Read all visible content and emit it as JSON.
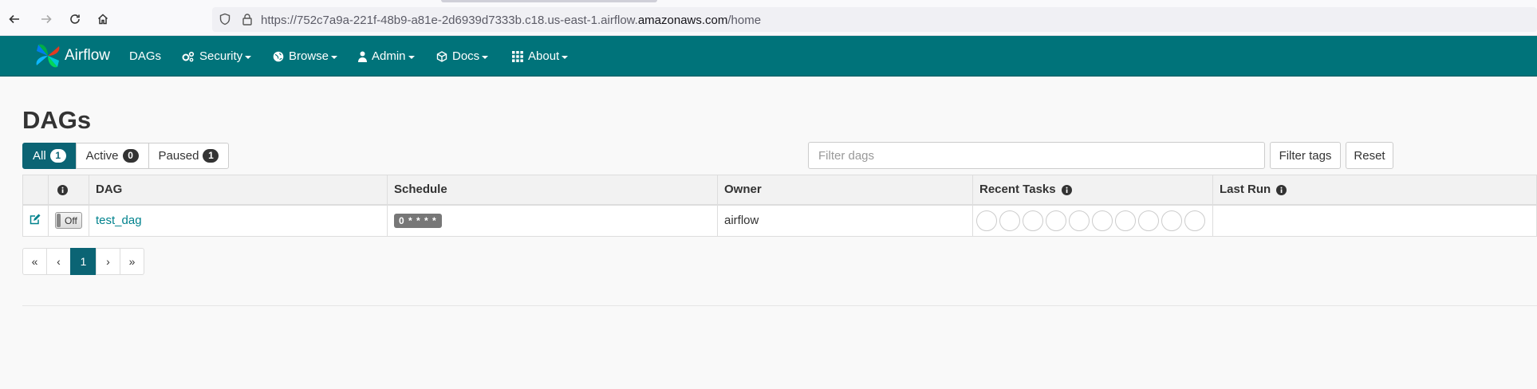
{
  "browser": {
    "url_prefix": "https://752c7a9a-221f-48b9-a81e-2d6939d7333b.c18.us-east-1.airflow.",
    "url_host": "amazonaws.com",
    "url_suffix": "/home"
  },
  "navbar": {
    "brand": "Airflow",
    "items": [
      {
        "label": "DAGs",
        "icon": "none"
      },
      {
        "label": "Security",
        "icon": "cogs-icon"
      },
      {
        "label": "Browse",
        "icon": "globe-icon"
      },
      {
        "label": "Admin",
        "icon": "user-icon"
      },
      {
        "label": "Docs",
        "icon": "cube-icon"
      },
      {
        "label": "About",
        "icon": "grid-icon"
      }
    ]
  },
  "page": {
    "title": "DAGs"
  },
  "status_filters": [
    {
      "label": "All",
      "count": "1",
      "active": true
    },
    {
      "label": "Active",
      "count": "0",
      "active": false
    },
    {
      "label": "Paused",
      "count": "1",
      "active": false
    }
  ],
  "filter": {
    "placeholder": "Filter dags",
    "filter_tags_label": "Filter tags",
    "reset_label": "Reset"
  },
  "table": {
    "headers": {
      "dag": "DAG",
      "schedule": "Schedule",
      "owner": "Owner",
      "recent_tasks": "Recent Tasks",
      "last_run": "Last Run"
    },
    "rows": [
      {
        "toggle_state": "Off",
        "dag_id": "test_dag",
        "schedule": "0 * * * *",
        "owner": "airflow",
        "recent_task_circles": 10,
        "last_run": ""
      }
    ]
  },
  "pagination": {
    "first": "«",
    "prev": "‹",
    "current": "1",
    "next": "›",
    "last": "»"
  },
  "colors": {
    "navbar": "#00737a",
    "accent": "#0b6474",
    "link": "#00828d"
  }
}
